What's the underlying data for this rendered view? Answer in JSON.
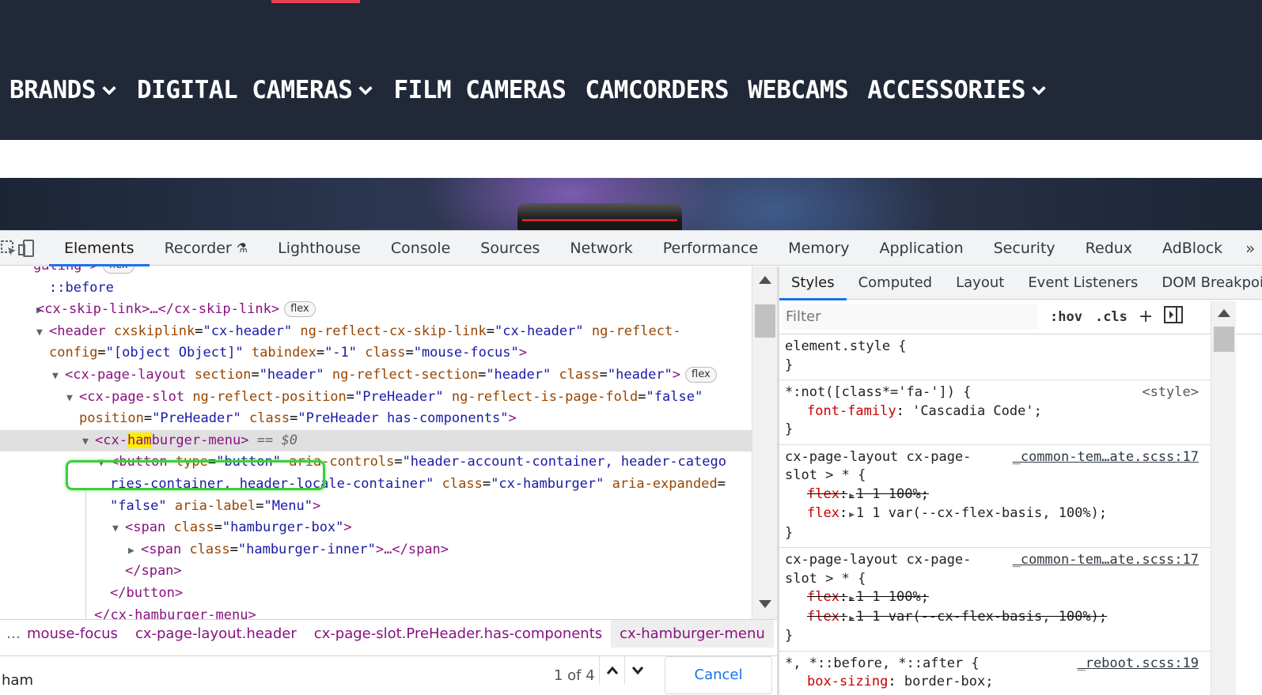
{
  "site": {
    "nav": [
      {
        "label": "BRANDS",
        "has_dropdown": true
      },
      {
        "label": "DIGITAL CAMERAS",
        "has_dropdown": true
      },
      {
        "label": "FILM CAMERAS",
        "has_dropdown": false
      },
      {
        "label": "CAMCORDERS",
        "has_dropdown": false
      },
      {
        "label": "WEBCAMS",
        "has_dropdown": false
      },
      {
        "label": "ACCESSORIES",
        "has_dropdown": true
      }
    ],
    "colors": {
      "header_bg": "#212837",
      "accent": "#e54552"
    }
  },
  "devtools": {
    "tabs": [
      "Elements",
      "Recorder",
      "Lighthouse",
      "Console",
      "Sources",
      "Network",
      "Performance",
      "Memory",
      "Application",
      "Security",
      "Redux",
      "AdBlock"
    ],
    "more_tabs": "»",
    "dom": {
      "line0_text": "gating >",
      "line0_badge": "flex",
      "line1": "::before",
      "line2_open": "<cx-skip-link>",
      "line2_ellipsis": "…",
      "line2_close": "</cx-skip-link>",
      "line2_badge": "flex",
      "header_tag": "<header",
      "header_a1n": "cxskiplink",
      "header_a1v": "\"cx-header\"",
      "header_a2n": "ng-reflect-cx-skip-link",
      "header_a2v": "\"cx-header\"",
      "header_a3n": "ng-reflect-",
      "header_a3n2": "config",
      "header_a3v": "\"[object Object]\"",
      "header_a4n": "tabindex",
      "header_a4v": "\"-1\"",
      "header_a5n": "class",
      "header_a5v": "\"mouse-focus\"",
      "layout_tag": "<cx-page-layout",
      "layout_a1n": "section",
      "layout_a1v": "\"header\"",
      "layout_a2n": "ng-reflect-section",
      "layout_a2v": "\"header\"",
      "layout_a3n": "class",
      "layout_a3v": "\"header\"",
      "layout_badge": "flex",
      "slot_tag": "<cx-page-slot",
      "slot_a1n": "ng-reflect-position",
      "slot_a1v": "\"PreHeader\"",
      "slot_a2n": "ng-reflect-is-page-fold",
      "slot_a2v": "\"false\"",
      "slot_a3n": "position",
      "slot_a3v": "\"PreHeader\"",
      "slot_a4n": "class",
      "slot_a4v": "\"PreHeader has-components\"",
      "ham_pre": "<cx-",
      "ham_hl": "ham",
      "ham_post": "burger-menu>",
      "ham_eq": "== $0",
      "btn_tag": "<button",
      "btn_a1n": "type",
      "btn_a1v": "\"button\"",
      "btn_a2n": "aria-controls",
      "btn_a2v1": "\"header-account-container, header-catego",
      "btn_a2v2": "ries-container, header-locale-container\"",
      "btn_a3n": "class",
      "btn_a3v": "\"cx-hamburger\"",
      "btn_a4n": "aria-expanded",
      "btn_a4v": "\"false\"",
      "btn_a5n": "aria-label",
      "btn_a5v": "\"Menu\"",
      "span_tag": "<span",
      "span_an": "class",
      "span_av": "\"hamburger-box\"",
      "inner_an": "class",
      "inner_av": "\"hamburger-inner\"",
      "inner_ellipsis": "…",
      "close_span": "</span>",
      "close_button": "</button>",
      "close_ham": "</cx-hamburger-menu>"
    },
    "breadcrumbs": [
      "mouse-focus",
      "cx-page-layout.header",
      "cx-page-slot.PreHeader.has-components",
      "cx-hamburger-menu"
    ],
    "breadcrumb_ellipsis": "…",
    "search": {
      "value": "ham",
      "count": "1 of 4",
      "cancel": "Cancel"
    },
    "styles": {
      "tabs": [
        "Styles",
        "Computed",
        "Layout",
        "Event Listeners",
        "DOM Breakpoints"
      ],
      "filter_placeholder": "Filter",
      "hov": ":hov",
      "cls": ".cls",
      "rules": {
        "r0_selector": "element.style {",
        "r0_close": "}",
        "r1_selector": "*:not([class*='fa-']) {",
        "r1_source": "<style>",
        "r1_prop": "font-family",
        "r1_val": "'Cascadia Code';",
        "r1_close": "}",
        "r2_selector1": "cx-page-layout cx-page-",
        "r2_selector2": "slot > * {",
        "r2_source": "_common-tem…ate.scss:17",
        "r2_p1": "flex",
        "r2_v1": "1 1 100%;",
        "r2_p2": "flex",
        "r2_v2": "1 1 var(--cx-flex-basis, 100%);",
        "r2_close": "}",
        "r3_selector1": "cx-page-layout cx-page-",
        "r3_selector2": "slot > * {",
        "r3_source": "_common-tem…ate.scss:17",
        "r3_p1": "flex",
        "r3_v1": "1 1 100%;",
        "r3_p2": "flex",
        "r3_v2": "1 1 var(--cx-flex-basis, 100%);",
        "r3_close": "}",
        "r4_selector": "*, *::before, *::after {",
        "r4_source": "_reboot.scss:19",
        "r4_prop": "box-sizing",
        "r4_val": "border-box;"
      }
    }
  }
}
